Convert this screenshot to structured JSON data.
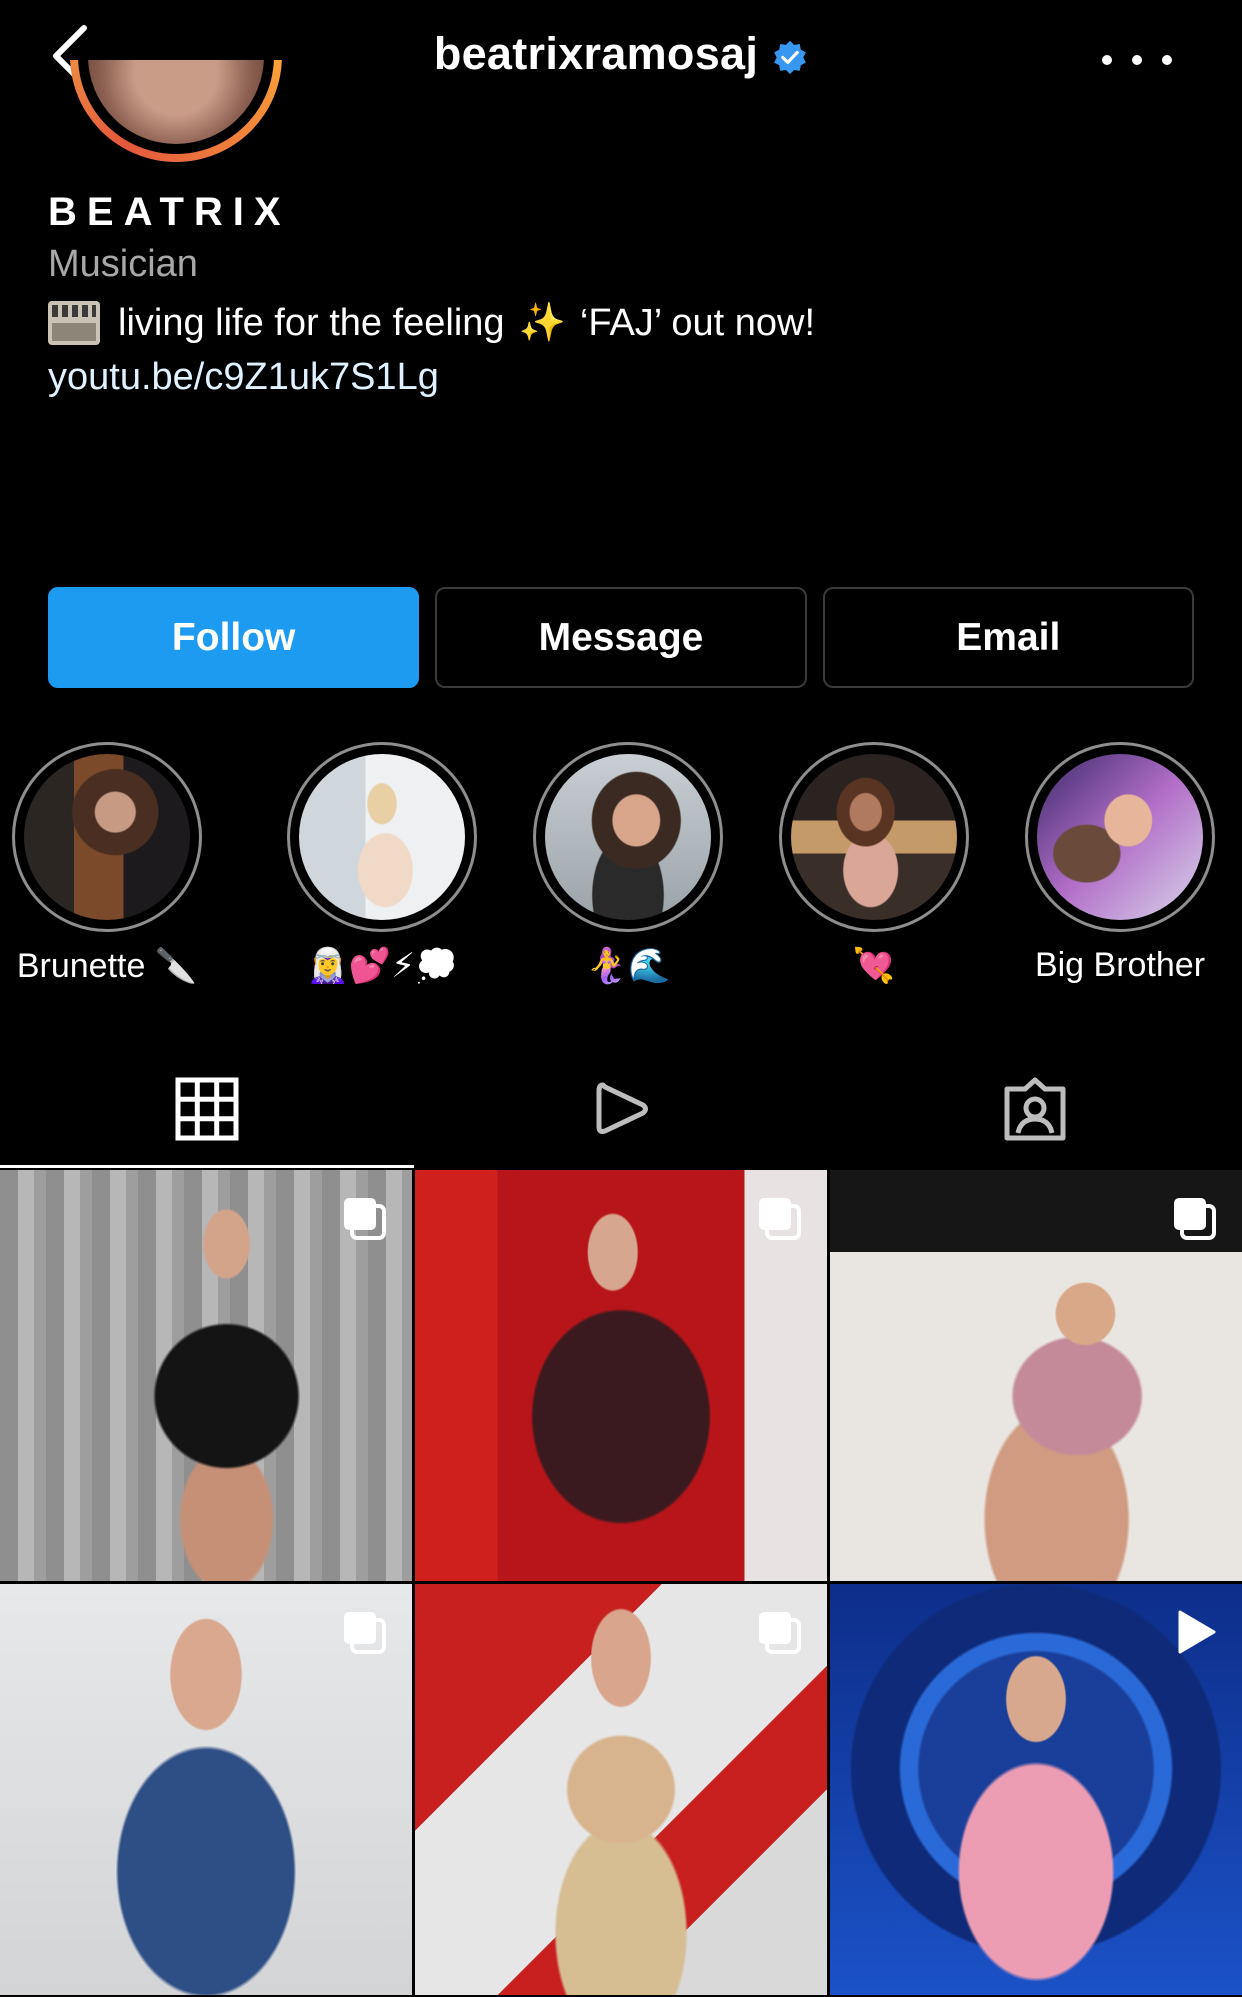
{
  "header": {
    "username": "beatrixramosaj",
    "back_icon": "chevron-left-icon",
    "verified_icon": "verified-badge-icon",
    "more_icon": "more-horizontal-icon",
    "verified_color": "#3897f0"
  },
  "profile": {
    "display_name": "BEATRIX",
    "category": "Musician",
    "bio": {
      "emoji_icon": "film-frames-icon",
      "text_before": "living life for the feeling",
      "sparkle": "✨",
      "text_after": "‘FAJ’ out now!"
    },
    "link": "youtu.be/c9Z1uk7S1Lg"
  },
  "actions": {
    "follow": "Follow",
    "message": "Message",
    "email": "Email",
    "accent": "#1d9bf0"
  },
  "highlights": [
    {
      "label": "Brunette 🔪"
    },
    {
      "label": "🧝‍♀️💕⚡💭"
    },
    {
      "label": "🧜‍♀️🌊"
    },
    {
      "label": "💘"
    },
    {
      "label": "Big Brother"
    }
  ],
  "tabs": [
    {
      "icon": "grid-icon",
      "active": true
    },
    {
      "icon": "reels-play-icon",
      "active": false
    },
    {
      "icon": "tagged-person-icon",
      "active": false
    }
  ],
  "posts": [
    {
      "badge": "carousel-icon"
    },
    {
      "badge": "carousel-icon"
    },
    {
      "badge": "carousel-icon"
    },
    {
      "badge": "carousel-icon"
    },
    {
      "badge": "carousel-icon"
    },
    {
      "badge": "video-play-icon"
    }
  ]
}
